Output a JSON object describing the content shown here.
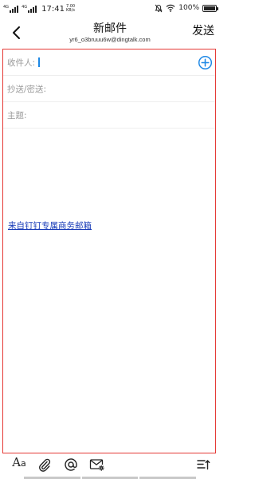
{
  "status_bar": {
    "network_1": "4G",
    "network_2": "4G",
    "time": "17:41",
    "speed_value": "7.00",
    "speed_unit": "KB/s",
    "battery": "100%",
    "icons": [
      "mute-icon",
      "wifi-icon",
      "battery-icon"
    ]
  },
  "header": {
    "title": "新邮件",
    "sender": "yr6_o3bruuu6w@dingtalk.com",
    "send_label": "发送",
    "back_icon": "chevron-left-icon"
  },
  "compose": {
    "to_label": "收件人:",
    "cc_label": "抄送/密送:",
    "subject_label": "主题:",
    "signature_link": "来自钉钉专属商务邮箱",
    "add_icon": "plus-circle-icon",
    "accent_color": "#1e88e5",
    "border_color": "#e53935"
  },
  "toolbar": {
    "font_label": "A",
    "font_label_small": "a",
    "icons": [
      "text-format-icon",
      "attachment-icon",
      "mention-icon",
      "mail-settings-icon",
      "sort-icon"
    ]
  }
}
